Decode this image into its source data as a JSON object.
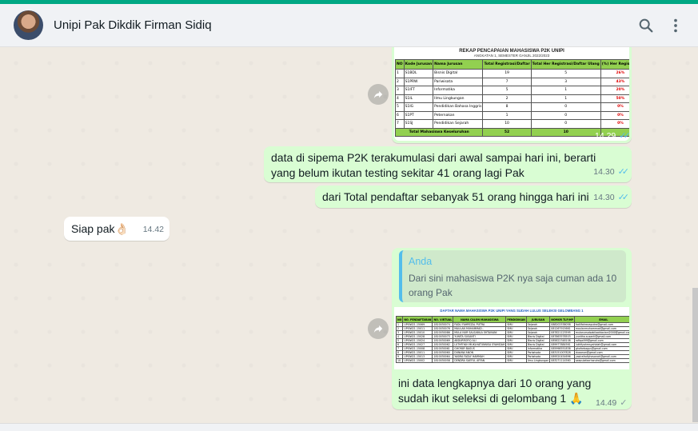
{
  "header": {
    "contact_name": "Unipi Pak Dikdik Firman Sidiq",
    "icons": [
      "search-icon",
      "more-vertical-icon"
    ],
    "accent": "#00a884"
  },
  "messages": {
    "m1": {
      "time": "14.29",
      "image": {
        "title": "REKAP PENCAPAIAN MAHASISWA P2K UNIPI",
        "subtitle": "ANGKATAN 1, SEMESTER GANJIL 2022/2023",
        "headers": [
          "NO",
          "Kode Jurusan",
          "Nama Jurusan",
          "Total Registrasi/Daftar",
          "Total Her Registrasi/Daftar Ulang",
          "(%) Her Registrasi"
        ],
        "rows": [
          [
            "1",
            "S1BDL",
            "Bisnis Digital",
            "19",
            "5",
            "26%"
          ],
          [
            "2",
            "S1PRW",
            "Pariwisata",
            "7",
            "3",
            "43%"
          ],
          [
            "3",
            "S1IFT",
            "Informatika",
            "5",
            "1",
            "20%"
          ],
          [
            "4",
            "S1IL",
            "Ilmu Lingkungan",
            "2",
            "1",
            "50%"
          ],
          [
            "5",
            "S1IG",
            "Pendidikan Bahasa Inggris",
            "8",
            "0",
            "0%"
          ],
          [
            "6",
            "S1PT",
            "Peternakan",
            "1",
            "0",
            "0%"
          ],
          [
            "7",
            "S1SJ",
            "Pendidikan Sejarah",
            "10",
            "0",
            "0%"
          ]
        ],
        "total_label": "Total Mahasiswa Keseluruhan",
        "total_daftar": "52",
        "total_her": "10"
      }
    },
    "m2": {
      "text": "data di sipema P2K terakumulasi dari awal sampai hari ini, berarti yang belum ikutan testing sekitar 41 orang lagi Pak",
      "time": "14.30"
    },
    "m3": {
      "text": "dari Total pendaftar sebanyak 51 orang hingga hari ini",
      "time": "14.30"
    },
    "m4": {
      "text": "Siap pak👌🏻",
      "time": "14.42"
    },
    "m5": {
      "quote_author": "Anda",
      "quote_text": "Dari sini mahasiswa P2K nya saja cuman ada 10 orang Pak",
      "image": {
        "title": "DAFTAR NAMA MAHASISWA P2K UNIPI YANG SUDAH LULUS SELEKSI GELOMBANG 1",
        "headers": [
          "NO",
          "NO. PENDAFTARAN",
          "NO. VIRTUAL",
          "NAMA CALON MAHASISWA",
          "PENDIDIKAN",
          "JURUSAN",
          "NOMOR TLP/HP",
          "EMAIL"
        ],
        "rows": [
          [
            "1",
            "UPI0W21-15069",
            "1810030074",
            "FADLI FAHREZAL PUTRA",
            "SMU",
            "Sejarah",
            "088202538058",
            "fadlifahrezaputra@gmail.com"
          ],
          [
            "2",
            "UPI0W21-15011",
            "1810030076",
            "MAULAN MUHAMMAD..",
            "SMU",
            "Sejarah",
            "081267915661",
            "maulanmuhammad@gmail.com"
          ],
          [
            "3",
            "UPI0W21-15010",
            "1810030086",
            "MULA NUR SALSABILA OKTAVIANI",
            "SMU",
            "Sejarah",
            "087821123595",
            "mulanursalsabilaoktaviani2000@gmail.com"
          ],
          [
            "4",
            "UPI0W21-15028",
            "1810030073",
            "YUNITA SUSANTI",
            "SMU",
            "Bisnis Digital",
            "087863578503",
            "yunitha.susanti@gmail.com"
          ],
          [
            "5",
            "UPI0W21-15024",
            "1810030069",
            "ABDURROFIQ ALI",
            "SMU",
            "Bisnis Digital",
            "085822348108",
            "rofiqali99@gmail.com"
          ],
          [
            "6",
            "UPI0W21-15027",
            "1810030062",
            "LUTHFIYAH MUKLHATUNNISA SYAHIDAH",
            "SMU",
            "Bisnis Digital",
            "089977884561",
            "luthfiyahmsyahidah@gmail.com"
          ],
          [
            "7",
            "UPI0W21-15008",
            "1810030061",
            "GHOFAR BAGUS",
            "SMU",
            "Informatika",
            "085998551838",
            "ghofarbagus@gmail.com"
          ],
          [
            "8",
            "UPI0W21-15011",
            "1810030060",
            "DUNIAW ANON",
            "SMU",
            "Pariwisata",
            "083151007828",
            "duaanon@gmail.com"
          ],
          [
            "9",
            "UPI0W21-15013",
            "1810030064",
            "YASIRA FADLY HAMMAH",
            "SMU",
            "Pariwisata",
            "089520454696",
            "yasirafadlyhasanah@gmail.com"
          ],
          [
            "10",
            "UPI0W21-15002",
            "1810030058",
            "DENDRA SAEFUL AFFAN",
            "SMU",
            "Ilmu Lingkungan",
            "083271114560",
            "saepulafaarhandra@gmail.com"
          ]
        ]
      },
      "text": "ini data lengkapnya dari 10 orang yang sudah ikut seleksi di gelombang 1 🙏",
      "time": "14.49"
    }
  }
}
